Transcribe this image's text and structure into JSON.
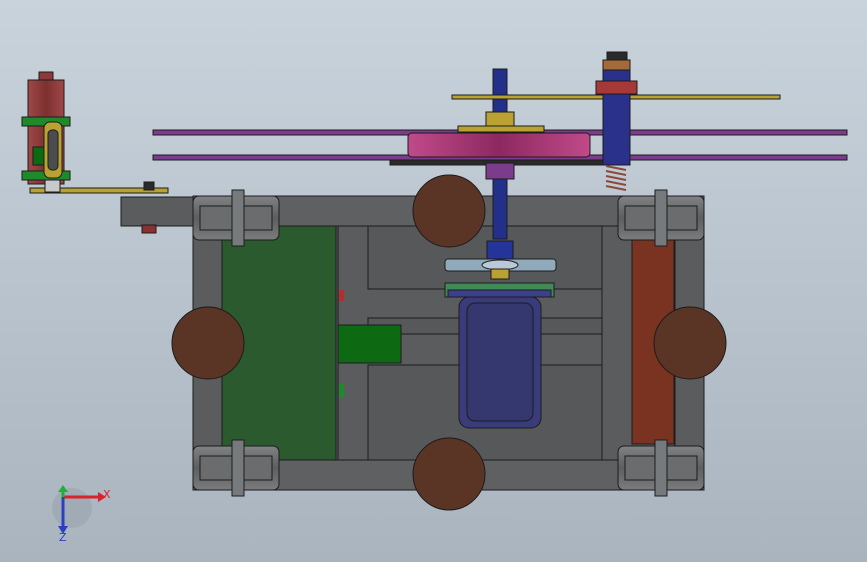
{
  "viewport": {
    "background_top": "#c9d3dc",
    "background_bottom": "#a9b4bf"
  },
  "triad": {
    "x_label": "X",
    "y_label": "Y",
    "z_label": "Z",
    "x_color": "#d8232a",
    "y_color": "#1fb03a",
    "z_color": "#2c3fc4"
  },
  "colors": {
    "frame": "#5a5c5e",
    "frame_dark": "#4a4c4e",
    "outline": "#1c1c1c",
    "wheel": "#5a3424",
    "green_panel": "#2b5a2e",
    "bright_green": "#0e6a12",
    "red_strip": "#7a3320",
    "motor_blue": "#393b7a",
    "shaft_blue": "#23308a",
    "pulley_magenta": "#a3336f",
    "plate_purple": "#7b3c8d",
    "brass": "#b9a232",
    "spring": "#8a4a3a",
    "cylinder": "#8a3a3a",
    "teal": "#5a9a9a"
  }
}
